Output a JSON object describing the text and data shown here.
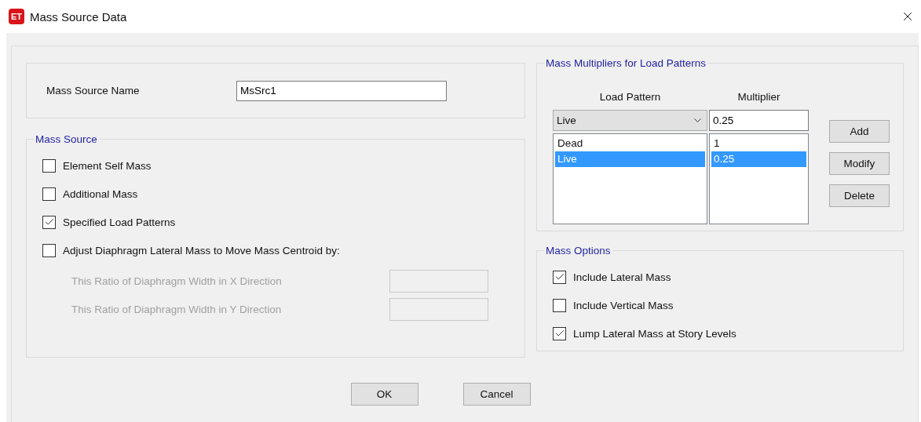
{
  "window": {
    "logo": "ET",
    "title": "Mass Source Data"
  },
  "name_field": {
    "label": "Mass Source Name",
    "value": "MsSrc1"
  },
  "mass_source": {
    "title": "Mass Source",
    "options": [
      {
        "label": "Element Self Mass",
        "checked": false
      },
      {
        "label": "Additional Mass",
        "checked": false
      },
      {
        "label": "Specified Load Patterns",
        "checked": true
      },
      {
        "label": "Adjust Diaphragm Lateral Mass to Move Mass Centroid by:",
        "checked": false
      }
    ],
    "ratio_fields": [
      {
        "label": "This Ratio of Diaphragm Width in X Direction",
        "disabled": true
      },
      {
        "label": "This Ratio of Diaphragm Width in Y Direction",
        "disabled": true
      }
    ]
  },
  "multipliers": {
    "title": "Mass Multipliers for Load Patterns",
    "columns": [
      "Load Pattern",
      "Multiplier"
    ],
    "pattern_select": "Live",
    "multiplier_value": "0.25",
    "rows": [
      {
        "pattern": "Dead",
        "multiplier": "1",
        "selected": false
      },
      {
        "pattern": "Live",
        "multiplier": "0.25",
        "selected": true
      }
    ],
    "buttons": [
      "Add",
      "Modify",
      "Delete"
    ]
  },
  "mass_options": {
    "title": "Mass Options",
    "options": [
      {
        "label": "Include Lateral Mass",
        "checked": true
      },
      {
        "label": "Include Vertical Mass",
        "checked": false
      },
      {
        "label": "Lump Lateral Mass at Story Levels",
        "checked": true
      }
    ]
  },
  "buttons": [
    "OK",
    "Cancel"
  ]
}
